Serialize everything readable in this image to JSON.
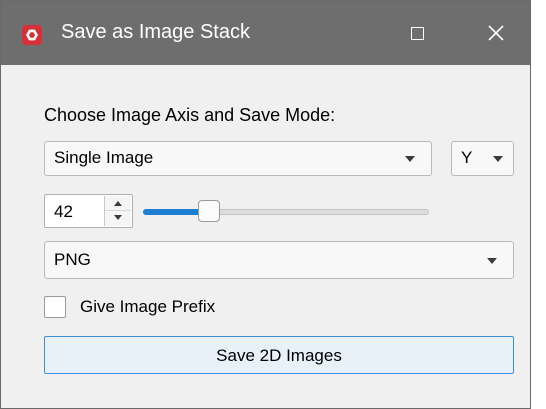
{
  "window": {
    "title": "Save as Image Stack"
  },
  "dialog": {
    "heading": "Choose Image Axis and Save Mode:",
    "save_mode": {
      "selected": "Single Image"
    },
    "axis": {
      "selected": "Y"
    },
    "slice_index": {
      "value": "42"
    },
    "slider": {
      "fraction": 0.21
    },
    "format": {
      "selected": "PNG"
    },
    "prefix_checkbox": {
      "label": "Give Image Prefix",
      "checked": false
    },
    "save_button": {
      "label": "Save 2D Images"
    }
  },
  "colors": {
    "titlebar": "#6e6e6e",
    "accent": "#1e7fd2",
    "app_icon": "#d7303b"
  },
  "icons": {
    "app": "app-logo-icon",
    "maximize": "maximize-icon",
    "close": "close-icon",
    "dropdown": "chevron-down-icon",
    "spin_up": "spin-up-icon",
    "spin_down": "spin-down-icon"
  }
}
